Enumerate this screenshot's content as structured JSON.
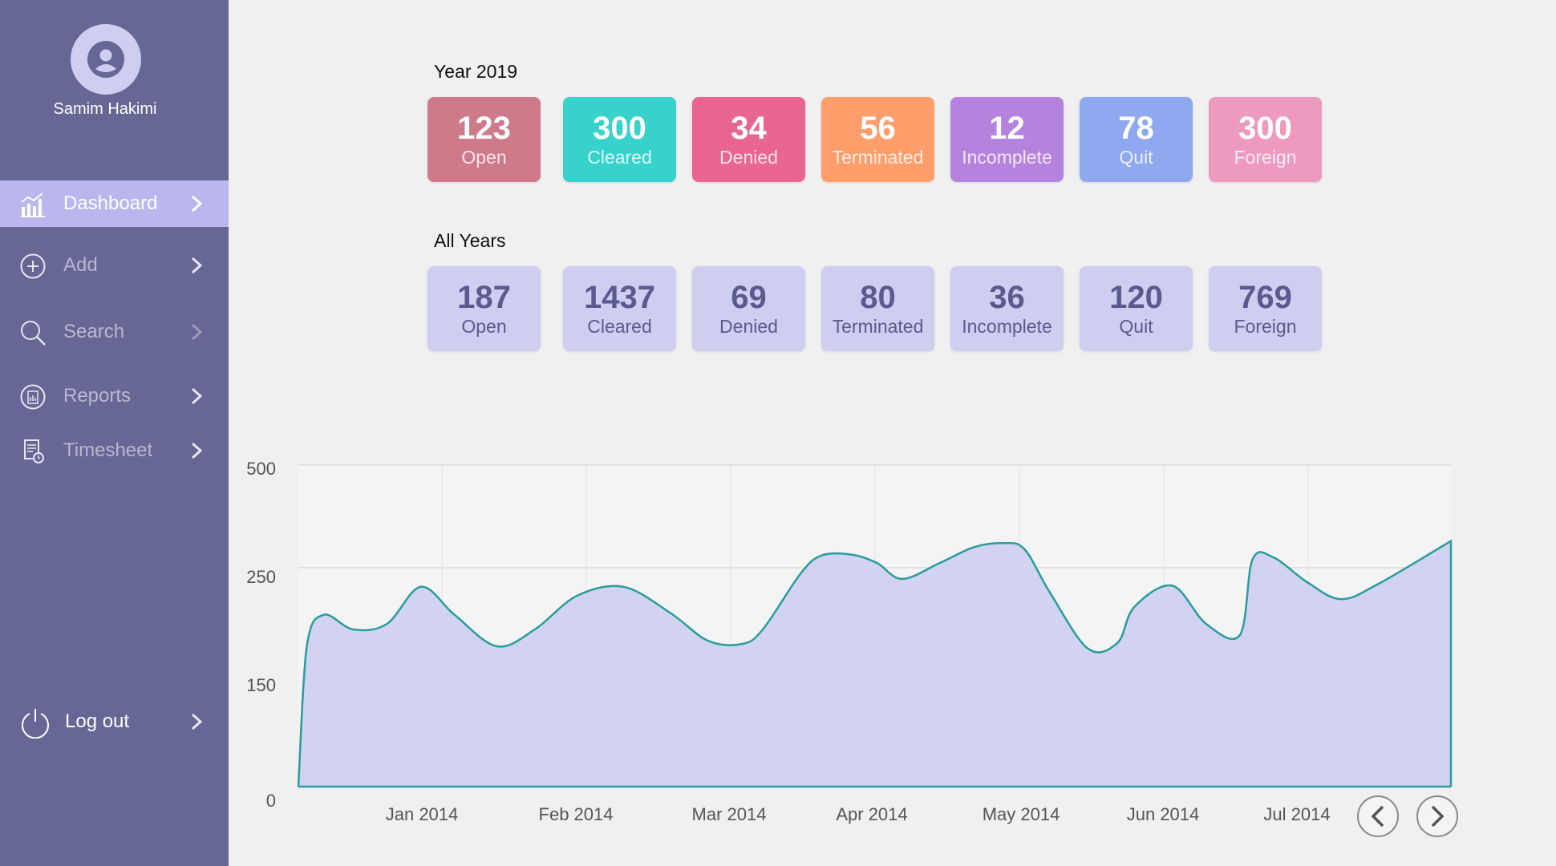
{
  "user": {
    "name": "Samim Hakimi"
  },
  "nav": {
    "items": [
      {
        "label": "Dashboard",
        "icon": "bar-chart-icon",
        "active": true
      },
      {
        "label": "Add",
        "icon": "plus-circle-icon"
      },
      {
        "label": "Search",
        "icon": "search-icon"
      },
      {
        "label": "Reports",
        "icon": "reports-icon"
      },
      {
        "label": "Timesheet",
        "icon": "timesheet-icon"
      }
    ],
    "logout_label": "Log out"
  },
  "year_section": {
    "title": "Year 2019",
    "cards": [
      {
        "value": "123",
        "label": "Open",
        "color": "#cf7a8a"
      },
      {
        "value": "300",
        "label": "Cleared",
        "color": "#38d2cc"
      },
      {
        "value": "34",
        "label": "Denied",
        "color": "#e96690"
      },
      {
        "value": "56",
        "label": "Terminated",
        "color": "#ff9e6b"
      },
      {
        "value": "12",
        "label": "Incomplete",
        "color": "#b582e0"
      },
      {
        "value": "78",
        "label": "Quit",
        "color": "#8fa8ef"
      },
      {
        "value": "300",
        "label": "Foreign",
        "color": "#ee9abf"
      }
    ]
  },
  "all_section": {
    "title": "All Years",
    "cards": [
      {
        "value": "187",
        "label": "Open"
      },
      {
        "value": "1437",
        "label": "Cleared"
      },
      {
        "value": "69",
        "label": "Denied"
      },
      {
        "value": "80",
        "label": "Terminated"
      },
      {
        "value": "36",
        "label": "Incomplete"
      },
      {
        "value": "120",
        "label": "Quit"
      },
      {
        "value": "769",
        "label": "Foreign"
      }
    ]
  },
  "colors": {
    "sidebar": "#676795",
    "active_nav": "#b9b7ee",
    "line": "#2a9d9a",
    "area": "#d0d0f0"
  },
  "chart_data": {
    "type": "area",
    "x_tick_labels": [
      "Jan 2014",
      "Feb 2014",
      "Mar 2014",
      "Apr 2014",
      "May 2014",
      "Jun 2014",
      "Jul 2014"
    ],
    "y_tick_labels": [
      "0",
      "150",
      "250",
      "500"
    ],
    "grid": true,
    "series": [
      {
        "points": [
          {
            "x": "2013-12-17",
            "y": 0
          },
          {
            "x": "2013-12-19",
            "y": 180
          },
          {
            "x": "2013-12-23",
            "y": 208
          },
          {
            "x": "2013-12-30",
            "y": 195
          },
          {
            "x": "2014-01-07",
            "y": 200
          },
          {
            "x": "2014-01-15",
            "y": 233
          },
          {
            "x": "2014-01-23",
            "y": 208
          },
          {
            "x": "2014-02-02",
            "y": 180
          },
          {
            "x": "2014-02-11",
            "y": 195
          },
          {
            "x": "2014-02-21",
            "y": 225
          },
          {
            "x": "2014-03-04",
            "y": 233
          },
          {
            "x": "2014-03-15",
            "y": 210
          },
          {
            "x": "2014-03-24",
            "y": 185
          },
          {
            "x": "2014-04-01",
            "y": 182
          },
          {
            "x": "2014-04-06",
            "y": 195
          },
          {
            "x": "2014-04-15",
            "y": 245
          },
          {
            "x": "2014-04-20",
            "y": 280
          },
          {
            "x": "2014-04-27",
            "y": 282
          },
          {
            "x": "2014-05-03",
            "y": 262
          },
          {
            "x": "2014-05-09",
            "y": 240
          },
          {
            "x": "2014-05-18",
            "y": 262
          },
          {
            "x": "2014-05-26",
            "y": 300
          },
          {
            "x": "2014-06-02",
            "y": 310
          },
          {
            "x": "2014-06-07",
            "y": 295
          },
          {
            "x": "2014-06-13",
            "y": 228
          },
          {
            "x": "2014-06-22",
            "y": 178
          },
          {
            "x": "2014-06-29",
            "y": 183
          },
          {
            "x": "2014-07-03",
            "y": 215
          },
          {
            "x": "2014-07-12",
            "y": 234
          },
          {
            "x": "2014-07-20",
            "y": 200
          },
          {
            "x": "2014-07-28",
            "y": 190
          },
          {
            "x": "2014-07-31",
            "y": 270
          },
          {
            "x": "2014-08-05",
            "y": 275
          },
          {
            "x": "2014-08-13",
            "y": 237
          },
          {
            "x": "2014-08-21",
            "y": 222
          },
          {
            "x": "2014-08-30",
            "y": 236
          },
          {
            "x": "2014-09-16",
            "y": 315
          }
        ]
      }
    ]
  }
}
